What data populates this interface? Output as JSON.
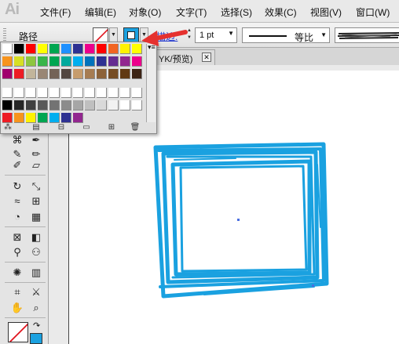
{
  "app": {
    "logo": "Ai"
  },
  "menu": [
    "文件(F)",
    "编辑(E)",
    "对象(O)",
    "文字(T)",
    "选择(S)",
    "效果(C)",
    "视图(V)",
    "窗口(W)"
  ],
  "control_bar": {
    "object_type": "路径",
    "stroke_label": "描边:",
    "stroke_weight": "1 pt",
    "profile_label": "等比",
    "fill_color": "none",
    "stroke_color": "#1aa1e0"
  },
  "document_tab": {
    "title": "YK/预览)",
    "close_glyph": "✕"
  },
  "swatches": {
    "rows": [
      [
        "#ffffff",
        "#000000",
        "#ff0000",
        "#ffff00",
        "#00a650",
        "#1e90ff",
        "#2e3192",
        "#ec008c",
        "#ff0000",
        "#f26522",
        "#fff200",
        "#ffff00"
      ],
      [
        "#f7941d",
        "#d7df23",
        "#8dc63f",
        "#39b54a",
        "#00a651",
        "#00a99d",
        "#00aeef",
        "#0072bc",
        "#2e3192",
        "#662d91",
        "#92278f",
        "#ec008c"
      ],
      [
        "#a0006d",
        "#ed1c24",
        "#c2b59b",
        "#998675",
        "#736357",
        "#534741",
        "#c69c6d",
        "#a67c52",
        "#8c6239",
        "#754c24",
        "#603913",
        "#3c2415"
      ],
      [
        "#ffffff",
        "#ffffff",
        "#ffffff",
        "#ffffff",
        "#ffffff",
        "#ffffff",
        "#ffffff",
        "#ffffff",
        "#ffffff",
        "#ffffff",
        "#ffffff",
        "#ffffff"
      ],
      [
        "#000000",
        "#262626",
        "#404040",
        "#595959",
        "#737373",
        "#8c8c8c",
        "#a6a6a6",
        "#bfbfbf",
        "#d9d9d9",
        "#f2f2f2",
        "#ffffff",
        "#ffffff"
      ],
      [
        "#ed1c24",
        "#f7941d",
        "#fff200",
        "#00a651",
        "#00aeef",
        "#2e3192",
        "#92278f"
      ]
    ]
  },
  "artwork": {
    "stroke_color": "#1aa1e0"
  }
}
